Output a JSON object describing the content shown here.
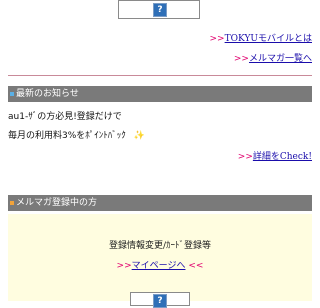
{
  "top_links": [
    {
      "prefix": ">>",
      "label": "TOKYUモバイルとは"
    },
    {
      "prefix": ">>",
      "label": "メルマガ一覧へ"
    }
  ],
  "news": {
    "title": "最新のお知らせ",
    "line1": "au1-ｻﾞの方必見!登録だけで",
    "line2": "毎月の利用料3%をﾎﾟｲﾝﾄﾊﾞｯｸ",
    "sparkle": "✨",
    "detail_prefix": ">>",
    "detail_label": "詳細をCheck!"
  },
  "mailmag": {
    "title": "メルマガ登録中の方",
    "change_text": "登録情報変更/ｶｰﾄﾞ登録等",
    "mypage_prefix": ">>",
    "mypage_label": "マイページへ",
    "mypage_suffix": "<<"
  },
  "colors": {
    "news_bullet": "#5ab0e6",
    "mailmag_bullet": "#f2a33a",
    "section_bar": "#7a7a7a",
    "arrow": "#e0006e",
    "highlight_bg": "#fffde0"
  },
  "icons": {
    "top_image": "question-image-icon",
    "bottom_image": "question-image-icon"
  },
  "icon_glyph": "?"
}
